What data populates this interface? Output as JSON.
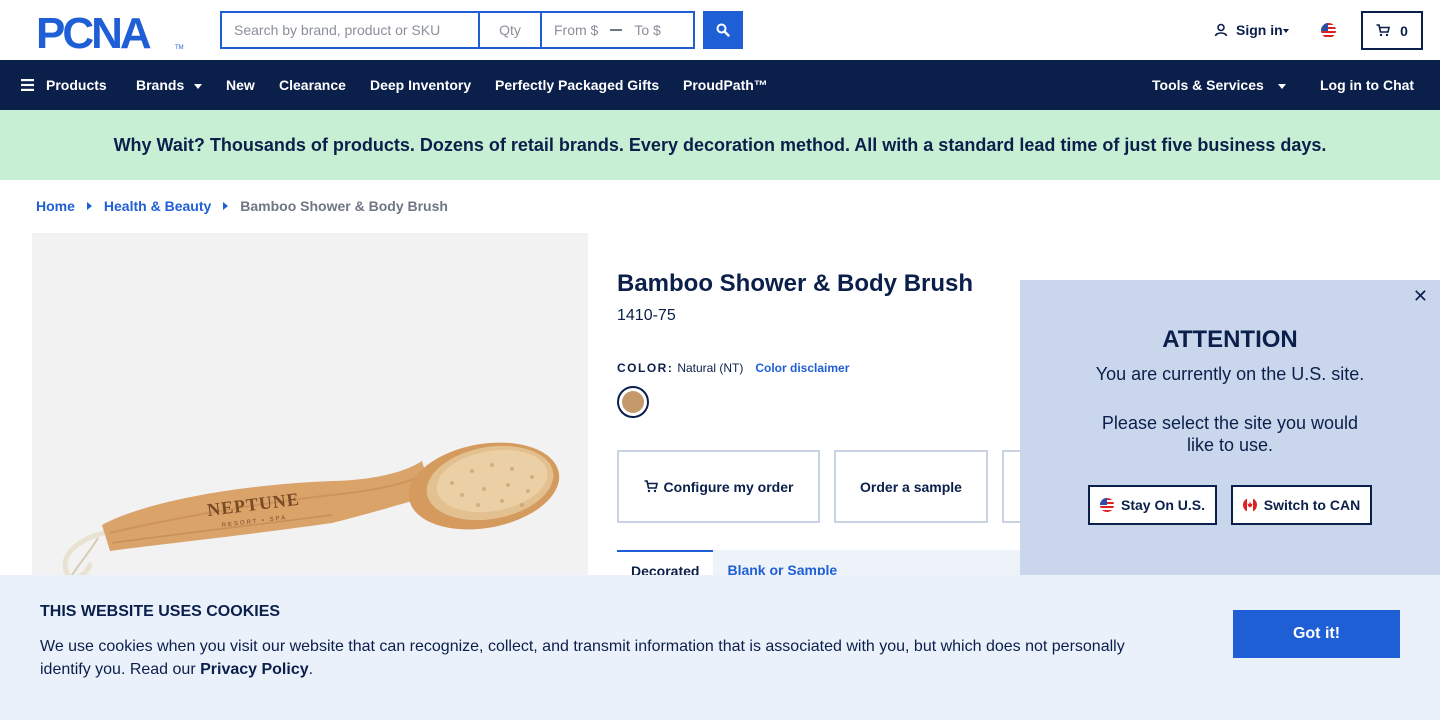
{
  "brand": {
    "logo_text": "PCNA",
    "logo_mark": "TM"
  },
  "search": {
    "placeholder": "Search by brand, product or SKU",
    "qty_placeholder": "Qty",
    "from_label": "From $",
    "to_label": "To $"
  },
  "header": {
    "signin_label": "Sign in",
    "cart_count": "0"
  },
  "nav": {
    "products": "Products",
    "brands": "Brands",
    "new": "New",
    "clearance": "Clearance",
    "deep_inventory": "Deep Inventory",
    "gifts": "Perfectly Packaged Gifts",
    "proudpath": "ProudPath™",
    "tools": "Tools & Services",
    "chat": "Log in to Chat"
  },
  "banner": {
    "text": "Why Wait? Thousands of products. Dozens of retail brands. Every decoration method. All with a standard lead time of just five business days."
  },
  "breadcrumb": {
    "home": "Home",
    "category": "Health & Beauty",
    "current": "Bamboo Shower & Body Brush"
  },
  "product": {
    "title": "Bamboo Shower & Body Brush",
    "sku": "1410-75",
    "color_label": "COLOR:",
    "color_value": "Natural (NT)",
    "color_disclaimer": "Color disclaimer",
    "swatch_color": "#c49a6c",
    "brush_imprint": "NEPTUNE",
    "brush_imprint_sub": "RESORT • SPA",
    "actions": {
      "configure": "Configure my order",
      "sample": "Order a sample"
    },
    "tabs": {
      "decorated": "Decorated",
      "blank": "Blank or Sample"
    }
  },
  "modal": {
    "heading": "ATTENTION",
    "line1": "You are currently on the U.S. site.",
    "line2": "Please select the site you would",
    "line3": "like to use.",
    "stay": "Stay On U.S.",
    "switch": "Switch to CAN"
  },
  "cookie": {
    "title": "THIS WEBSITE USES COOKIES",
    "body": "We use cookies when you visit our website that can recognize, collect, and transmit information that is associated with you, but which does not personally identify you. Read our ",
    "policy_link": "Privacy Policy",
    "period": ".",
    "button": "Got it!"
  },
  "colors": {
    "navy": "#0b1f4b",
    "accent_blue": "#1f5fd6",
    "banner_green": "#c6efd4",
    "modal_bg": "#c9d6ec",
    "cookie_bg": "#ebf1fb"
  }
}
